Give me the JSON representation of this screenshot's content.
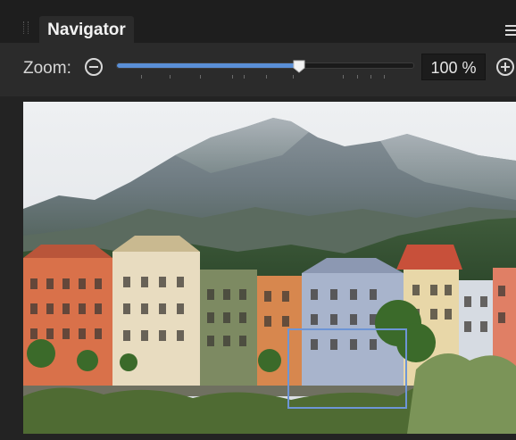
{
  "panel": {
    "tab_label": "Navigator",
    "menu_icon": "hamburger-menu-icon"
  },
  "zoom": {
    "label": "Zoom:",
    "value_text": "100 %",
    "slider_fraction": 0.62,
    "accent": "#5a8fd6"
  },
  "preview": {
    "viewport_color": "#6d95d6"
  }
}
